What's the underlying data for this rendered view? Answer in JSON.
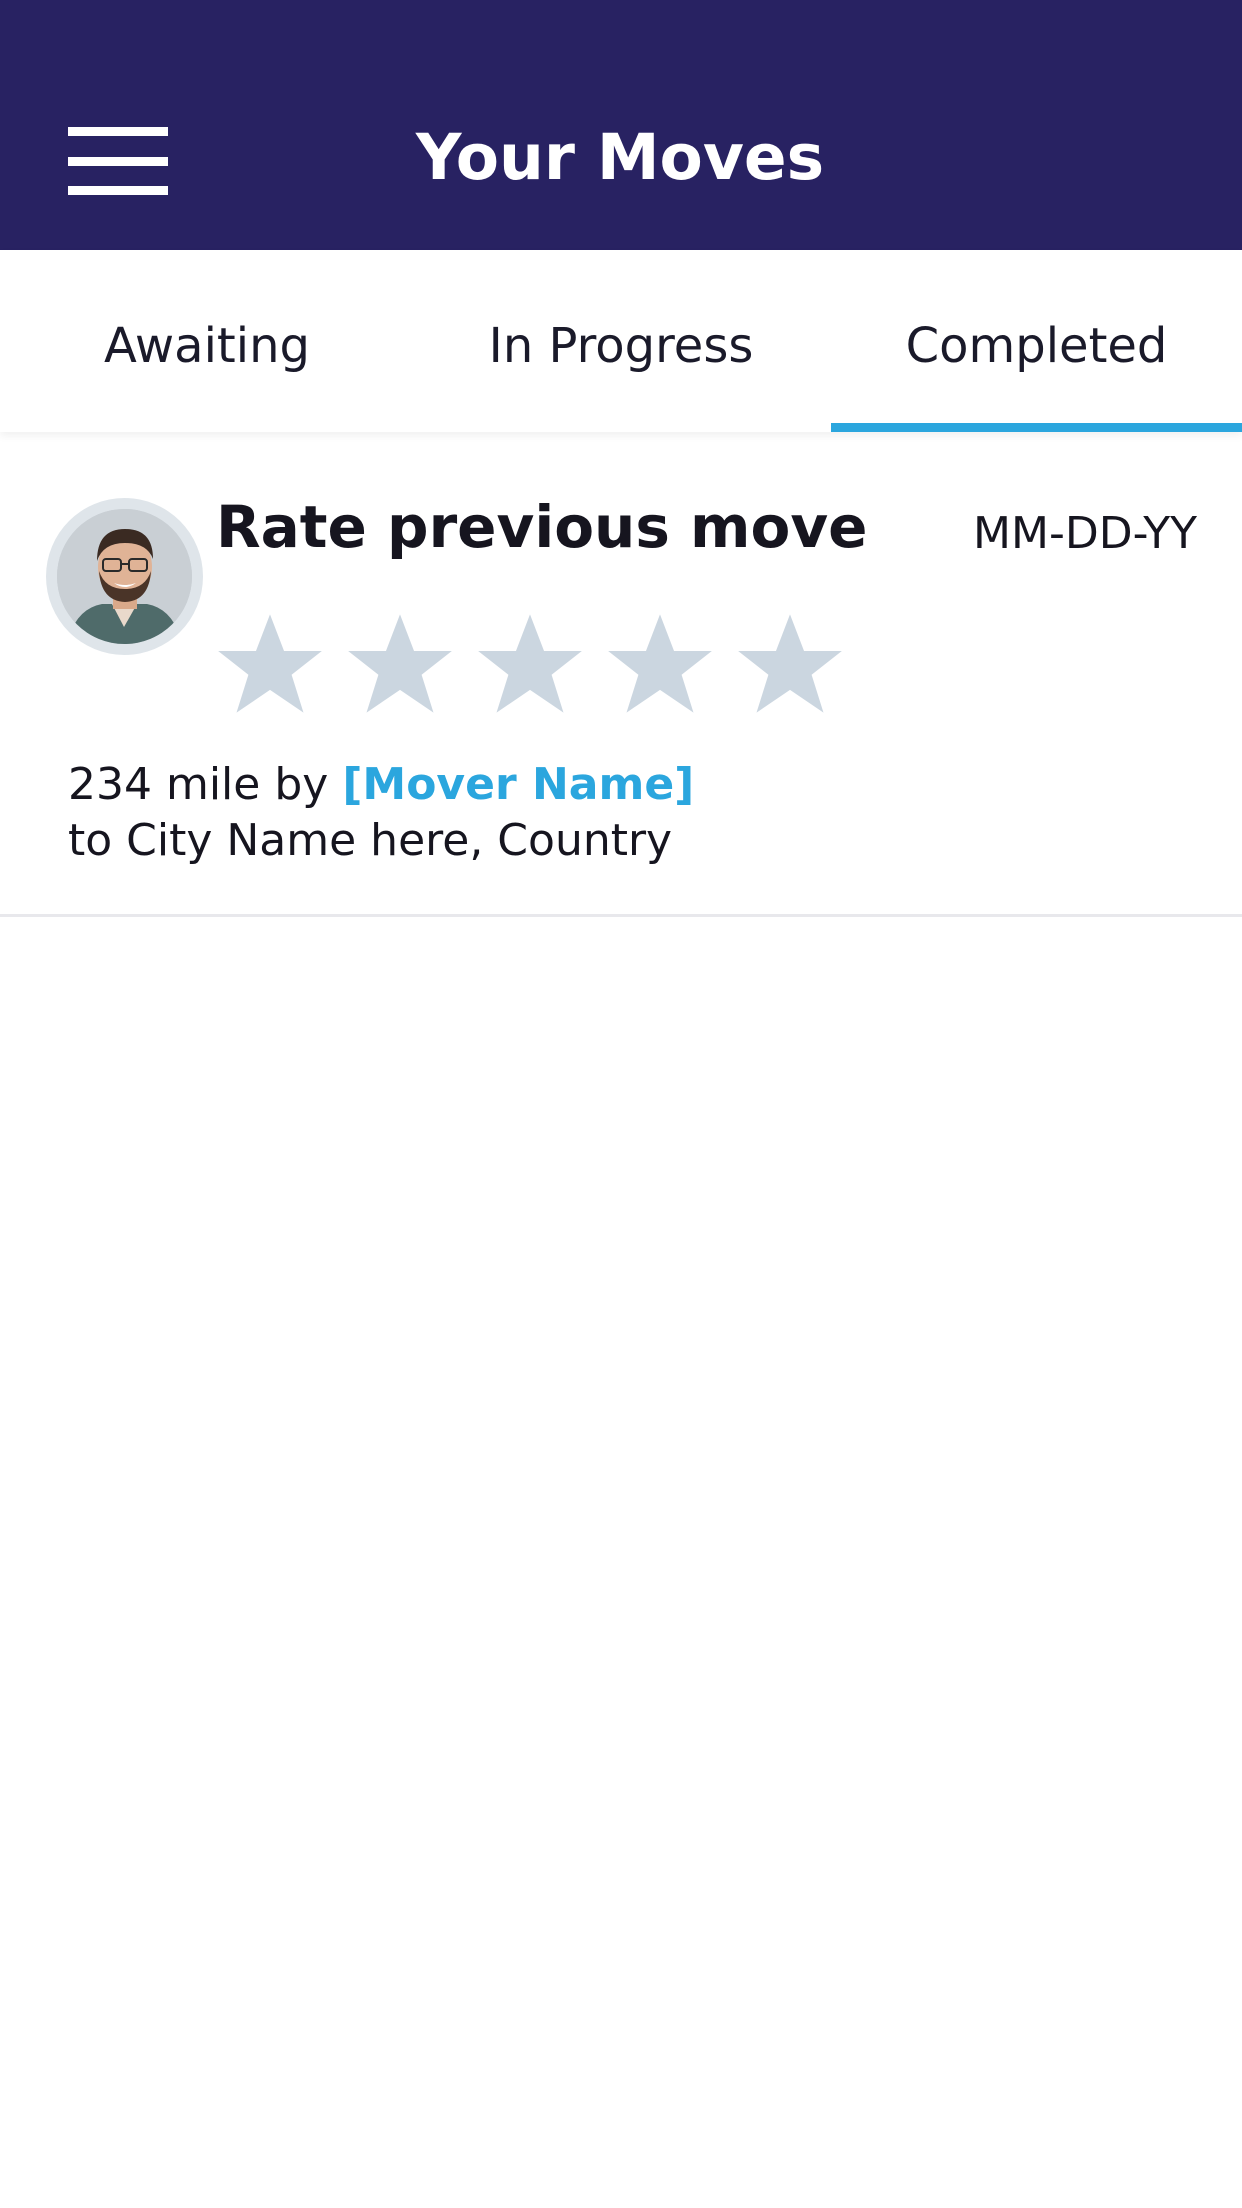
{
  "header": {
    "title": "Your Moves",
    "menu_icon": "hamburger-menu-icon",
    "background_color": "#282262"
  },
  "tabs": [
    {
      "label": "Awaiting",
      "active": false
    },
    {
      "label": "In Progress",
      "active": false
    },
    {
      "label": "Completed",
      "active": true
    }
  ],
  "accent_color": "#2ba6de",
  "move_card": {
    "title": "Rate previous move",
    "date": "MM-DD-YY",
    "avatar_icon": "user-avatar",
    "rating": {
      "value": 0,
      "max": 5
    },
    "distance_text": "234 mile by",
    "mover_name": "[Mover Name]",
    "destination": "to City Name here, Country"
  }
}
